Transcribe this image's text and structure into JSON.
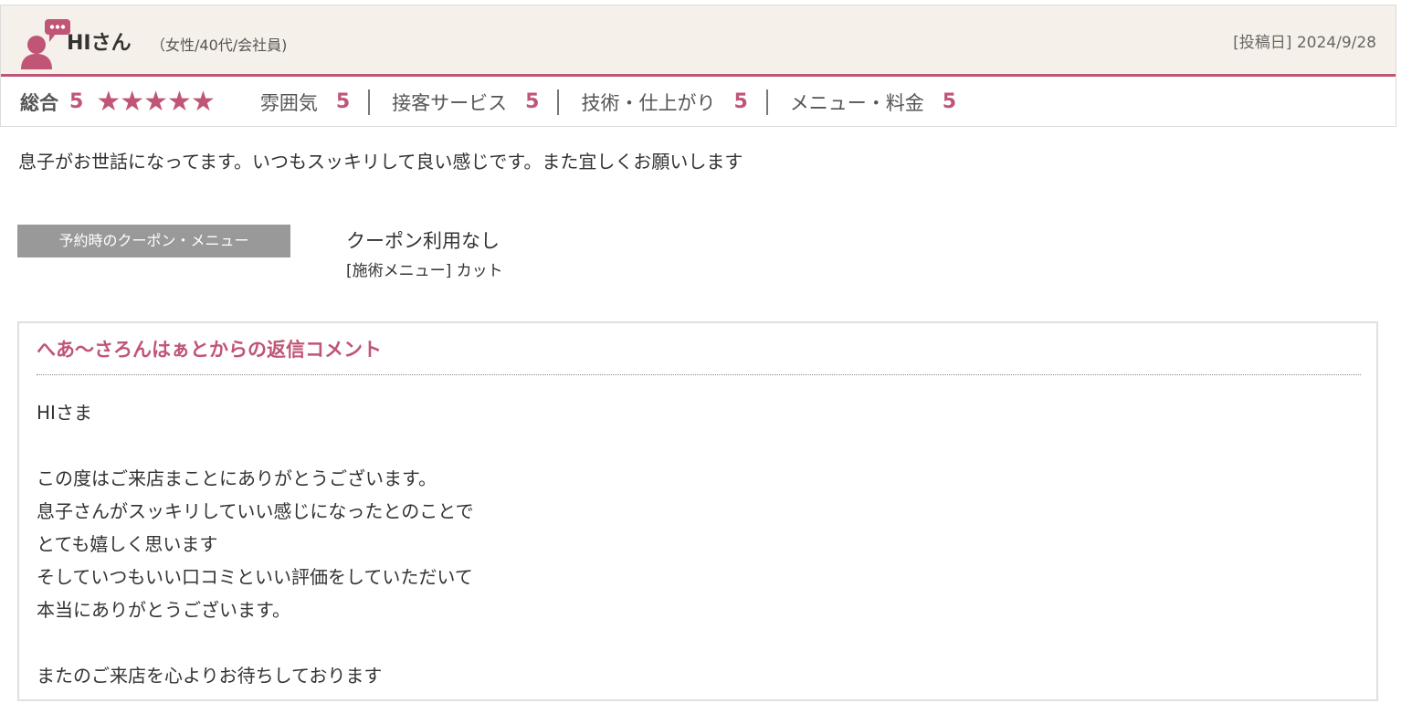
{
  "review": {
    "user_name": "HIさん",
    "user_attrs": "（女性/40代/会社員)",
    "post_date": "[投稿日] 2024/9/28",
    "overall_label": "総合",
    "overall_score": "5",
    "stars": 5,
    "categories": [
      {
        "label": "雰囲気",
        "score": "5"
      },
      {
        "label": "接客サービス",
        "score": "5"
      },
      {
        "label": "技術・仕上がり",
        "score": "5"
      },
      {
        "label": "メニュー・料金",
        "score": "5"
      }
    ],
    "text": "息子がお世話になってます。いつもスッキリして良い感じです。また宜しくお願いします"
  },
  "coupon": {
    "tag": "予約時のクーポン・メニュー",
    "value": "クーポン利用なし",
    "menu": "[施術メニュー] カット"
  },
  "reply": {
    "title": "へあ〜さろんはぁとからの返信コメント",
    "lines": [
      "HIさま",
      "",
      "この度はご来店まことにありがとうございます。",
      "息子さんがスッキリしていい感じになったとのことで",
      "とても嬉しく思います",
      "そしていつもいい口コミといい評価をしていただいて",
      "本当にありがとうございます。",
      "",
      "またのご来店を心よりお待ちしております"
    ]
  },
  "colors": {
    "accent": "#c05576",
    "header_bg": "#f5f1ea",
    "tag_bg": "#999999"
  }
}
